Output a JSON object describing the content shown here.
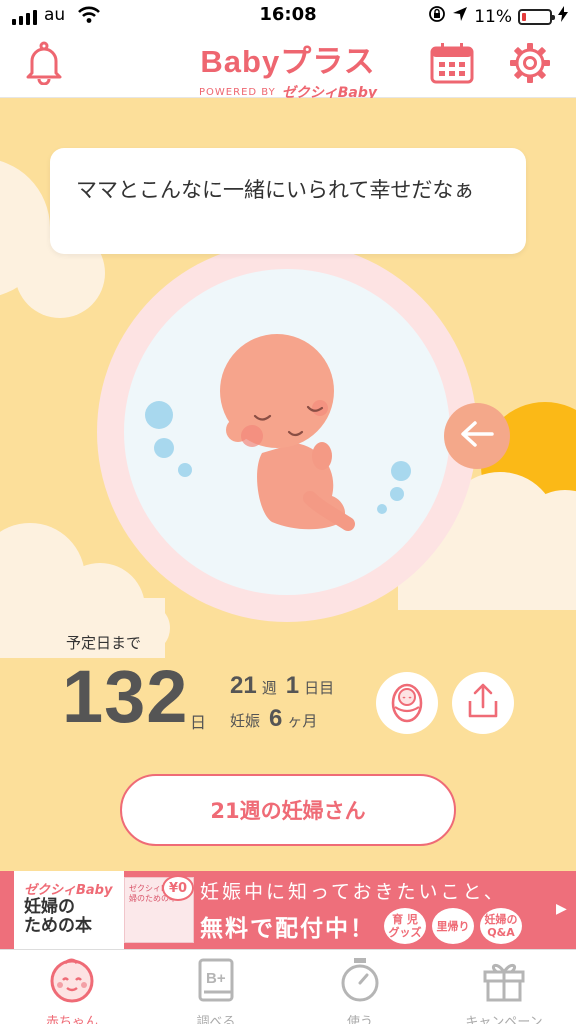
{
  "status_bar": {
    "carrier": "au",
    "time": "16:08",
    "battery": "11%"
  },
  "header": {
    "logo_main": "Babyプラス",
    "logo_powered": "POWERED BY",
    "logo_brand": "ゼクシィBaby",
    "icons": {
      "bell": "bell-icon",
      "calendar": "calendar-icon",
      "settings": "gear-icon"
    }
  },
  "baby": {
    "speech": "ママとこんなに一緒にいられて幸せだなぁ",
    "days_label": "予定日まで",
    "days_value": "132",
    "days_unit": "日",
    "week_value": "21",
    "week_unit": "週",
    "day_value": "1",
    "day_unit": "日目",
    "pregnancy_label": "妊娠",
    "month_value": "6",
    "month_unit": "ヶ月",
    "week_button": "21週の妊婦さん"
  },
  "ad": {
    "brand": "ゼクシィBaby",
    "title_line1": "妊婦の",
    "title_line2": "ための本",
    "book_text": "ゼクシィBaby 妊婦のための本",
    "price": "¥0",
    "line1": "妊娠中に知っておきたいこと、",
    "line2": "無料で配付中！",
    "chips": [
      {
        "l1": "育 児",
        "l2": "グッズ"
      },
      {
        "l1": "里帰り",
        "l2": ""
      },
      {
        "l1": "妊婦の",
        "l2": "Q&A"
      }
    ]
  },
  "tabs": [
    {
      "label": "赤ちゃん",
      "icon": "baby-face-icon",
      "active": true
    },
    {
      "label": "調べる",
      "icon": "book-icon",
      "active": false
    },
    {
      "label": "使う",
      "icon": "stopwatch-icon",
      "active": false
    },
    {
      "label": "キャンペーン",
      "icon": "gift-icon",
      "active": false
    }
  ],
  "colors": {
    "brand": "#ef6b76",
    "background": "#fcdf9a",
    "accent": "#f4a88a",
    "sun": "#fbb917"
  }
}
